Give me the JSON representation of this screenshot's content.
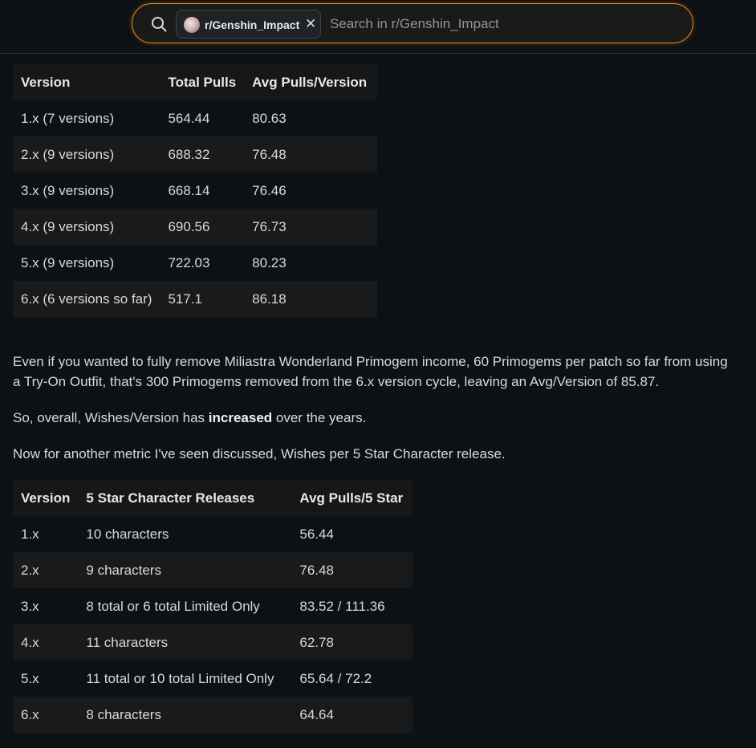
{
  "search": {
    "chip_label": "r/Genshin_Impact",
    "placeholder": "Search in r/Genshin_Impact",
    "accent_color": "#e9891a"
  },
  "table1": {
    "headers": [
      "Version",
      "Total Pulls",
      "Avg Pulls/Version"
    ],
    "rows": [
      [
        "1.x (7 versions)",
        "564.44",
        "80.63"
      ],
      [
        "2.x (9 versions)",
        "688.32",
        "76.48"
      ],
      [
        "3.x (9 versions)",
        "668.14",
        "76.46"
      ],
      [
        "4.x (9 versions)",
        "690.56",
        "76.73"
      ],
      [
        "5.x (9 versions)",
        "722.03",
        "80.23"
      ],
      [
        "6.x (6 versions so far)",
        "517.1",
        "86.18"
      ]
    ]
  },
  "paragraphs": {
    "p1": "Even if you wanted to fully remove Miliastra Wonderland Primogem income, 60 Primogems per patch so far from using a Try-On Outfit, that's 300 Primogems removed from the 6.x version cycle, leaving an Avg/Version of 85.87.",
    "p2_before": "So, overall, Wishes/Version has ",
    "p2_bold": "increased",
    "p2_after": " over the years.",
    "p3": "Now for another metric I've seen discussed, Wishes per 5 Star Character release."
  },
  "table2": {
    "headers": [
      "Version",
      "5 Star Character Releases",
      "Avg Pulls/5 Star"
    ],
    "rows": [
      [
        "1.x",
        "10 characters",
        "56.44"
      ],
      [
        "2.x",
        "9 characters",
        "76.48"
      ],
      [
        "3.x",
        "8 total or 6 total Limited Only",
        "83.52 / 111.36"
      ],
      [
        "4.x",
        "11 characters",
        "62.78"
      ],
      [
        "5.x",
        "11 total or 10 total Limited Only",
        "65.64 / 72.2"
      ],
      [
        "6.x",
        "8 characters",
        "64.64"
      ]
    ]
  }
}
